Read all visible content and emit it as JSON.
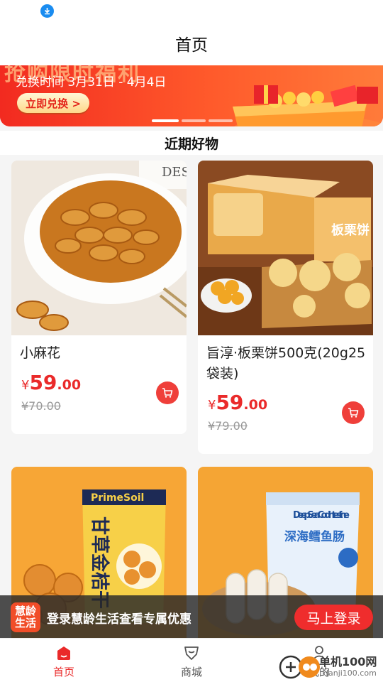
{
  "header": {
    "title": "首页"
  },
  "banner": {
    "headline": "抢购限时福利",
    "date_text": "兑换时间 3月31日 - 4月4日",
    "button_label": "立即兑换 >"
  },
  "section": {
    "title": "近期好物"
  },
  "products": [
    {
      "name": "小麻花",
      "currency": "¥",
      "price_int": "59",
      "price_dec": ".00",
      "original_price": "¥70.00"
    },
    {
      "name": "旨淳·板栗饼500克(20g25袋装)",
      "currency": "¥",
      "price_int": "59",
      "price_dec": ".00",
      "original_price": "¥79.00"
    },
    {
      "name": "甘草金桔干",
      "package_brand": "PrimeSoil",
      "package_title": "甘草金桔干"
    },
    {
      "name": "深海鳕鱼肠",
      "package_brand": "Deep Sea Cod Intestine",
      "package_title": "深海鳕鱼肠"
    }
  ],
  "box_label": "板栗饼",
  "login_bar": {
    "logo_line1": "慧龄",
    "logo_line2": "生活",
    "text": "登录慧龄生活查看专属优惠",
    "button_label": "马上登录"
  },
  "tabbar": {
    "items": [
      {
        "label": "首页",
        "icon": "home-icon",
        "active": true
      },
      {
        "label": "商城",
        "icon": "shop-icon",
        "active": false
      },
      {
        "label": "我的",
        "icon": "user-icon",
        "active": false
      }
    ]
  },
  "watermark": {
    "text": "单机100网",
    "url": "danji100.com"
  },
  "colors": {
    "accent": "#ea2a2a",
    "banner": "#f63a2a",
    "login_bar": "#282828"
  }
}
